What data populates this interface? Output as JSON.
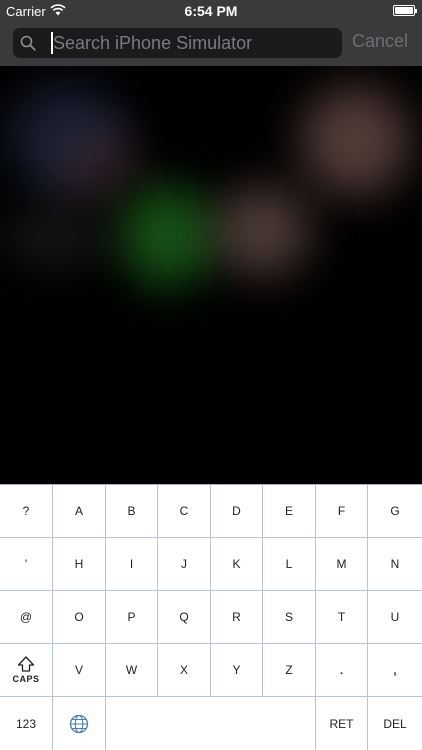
{
  "status_bar": {
    "carrier": "Carrier",
    "time": "6:54 PM"
  },
  "search": {
    "placeholder": "Search iPhone Simulator",
    "value": "",
    "cancel_label": "Cancel"
  },
  "keyboard": {
    "rows": [
      [
        "?",
        "A",
        "B",
        "C",
        "D",
        "E",
        "F",
        "G"
      ],
      [
        "'",
        "H",
        "I",
        "J",
        "K",
        "L",
        "M",
        "N"
      ],
      [
        "@",
        "O",
        "P",
        "Q",
        "R",
        "S",
        "T",
        "U"
      ],
      [
        "",
        "V",
        "W",
        "X",
        "Y",
        "Z",
        ".",
        ","
      ]
    ],
    "caps_label": "CAPS",
    "numbers_label": "123",
    "return_label": "RET",
    "delete_label": "DEL"
  }
}
